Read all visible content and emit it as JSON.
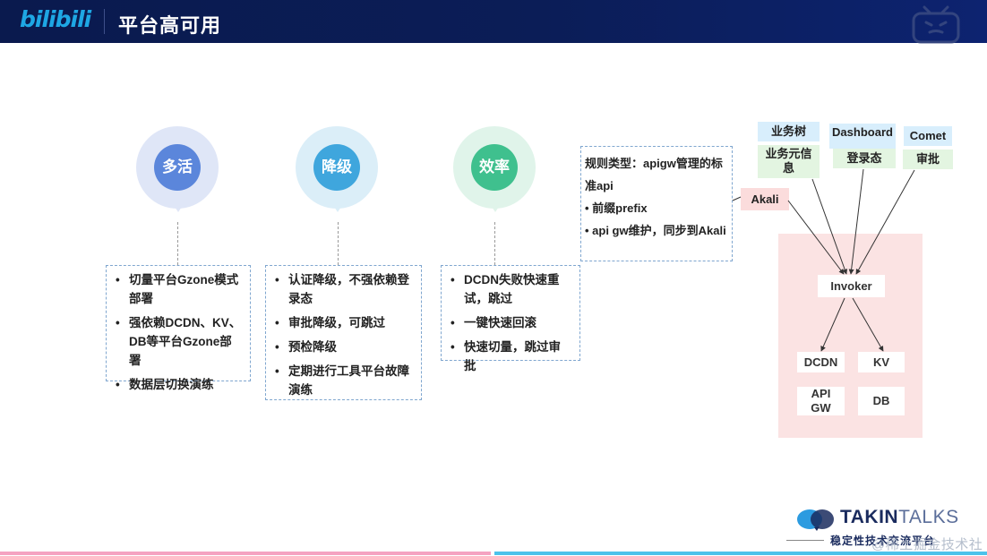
{
  "header": {
    "logo_text": "bilibili",
    "title": "平台高可用"
  },
  "circles": [
    {
      "label": "多活",
      "outer_color": "#dfe6f7",
      "inner_color": "#5b86db"
    },
    {
      "label": "降级",
      "outer_color": "#dbeef8",
      "inner_color": "#3fa6dd"
    },
    {
      "label": "效率",
      "outer_color": "#e0f4ea",
      "inner_color": "#3fc08e"
    }
  ],
  "boxes": [
    {
      "items": [
        "切量平台Gzone模式部署",
        "强依赖DCDN、KV、DB等平台Gzone部署",
        "数据层切换演练"
      ]
    },
    {
      "items": [
        "认证降级，不强依赖登录态",
        "审批降级，可跳过",
        "预检降级",
        "定期进行工具平台故障演练"
      ]
    },
    {
      "items": [
        "DCDN失败快速重试，跳过",
        "一键快速回滚",
        "快速切量，跳过审批"
      ]
    }
  ],
  "rule_box": {
    "line1": "规则类型：apigw管理的标准api",
    "line2": "• 前缀prefix",
    "line3": "• api gw维护，同步到Akali"
  },
  "diagram": {
    "akali": "Akali",
    "tags_top": [
      "业务树",
      "Dashboard",
      "Comet"
    ],
    "tags_bottom": [
      "业务元信息",
      "登录态",
      "审批"
    ],
    "invoker": "Invoker",
    "nodes": [
      "DCDN",
      "KV",
      "API GW",
      "DB"
    ]
  },
  "footer": {
    "brand_a": "TAKIN",
    "brand_b": "TALKS",
    "subtitle": "稳定性技术交流平台",
    "watermark": "@稀土掘金技术社区"
  },
  "colors": {
    "header_bg": "#0b1d57",
    "logo": "#1ea7e4",
    "box_border": "#7fa6cf",
    "pink_panel": "#fbe3e3",
    "tag_blue": "#d8eefc",
    "tag_green": "#e3f5e1"
  }
}
